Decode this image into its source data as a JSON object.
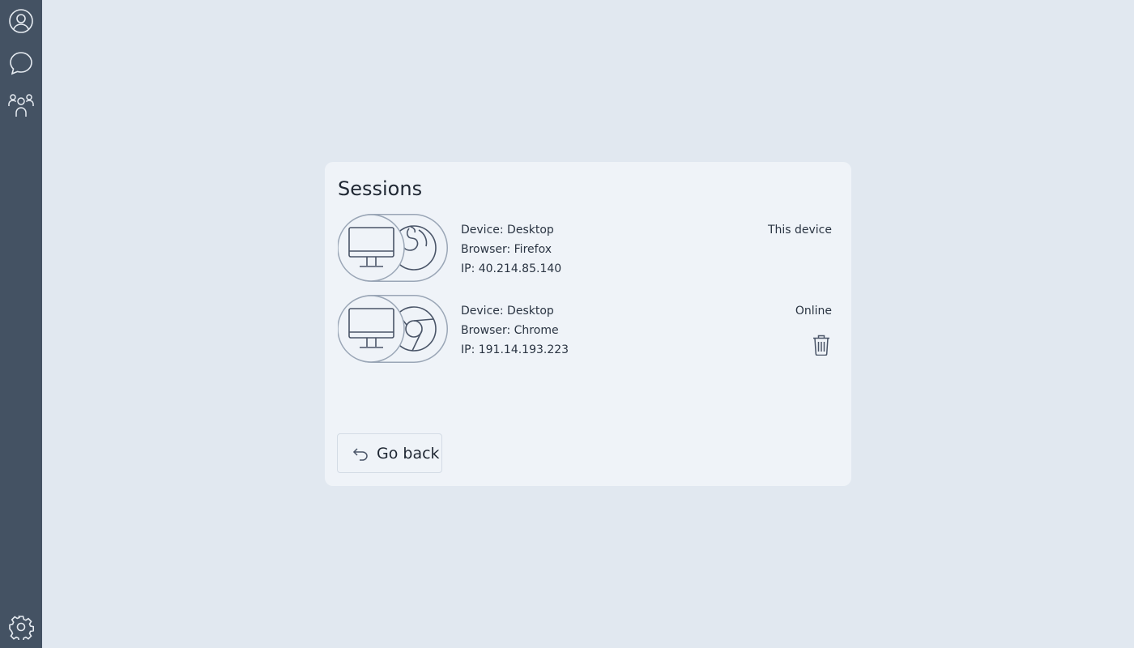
{
  "sidebar": {
    "items": [
      {
        "icon": "user-profile-icon"
      },
      {
        "icon": "chat-bubble-icon"
      },
      {
        "icon": "people-group-icon"
      }
    ],
    "bottom_icon": "gear-icon"
  },
  "card": {
    "title": "Sessions",
    "sessions": [
      {
        "device": "Device: Desktop",
        "browser": "Browser: Firefox",
        "ip": "IP: 40.214.85.140",
        "status": "This device",
        "device_icon": "desktop-monitor-icon",
        "browser_icon": "firefox-icon"
      },
      {
        "device": "Device: Desktop",
        "browser": "Browser: Chrome",
        "ip": "IP: 191.14.193.223",
        "status": "Online",
        "device_icon": "desktop-monitor-icon",
        "browser_icon": "chrome-icon",
        "action_icon": "trash-icon"
      }
    ],
    "back_button": {
      "label": "Go back",
      "icon": "return-arrow-icon"
    }
  },
  "colors": {
    "sidebar_bg": "#445263",
    "page_bg": "#e1e8f0",
    "card_bg": "#eff3f8",
    "icon_stroke": "#4a5568",
    "sidebar_icon": "#e6ebf1"
  }
}
